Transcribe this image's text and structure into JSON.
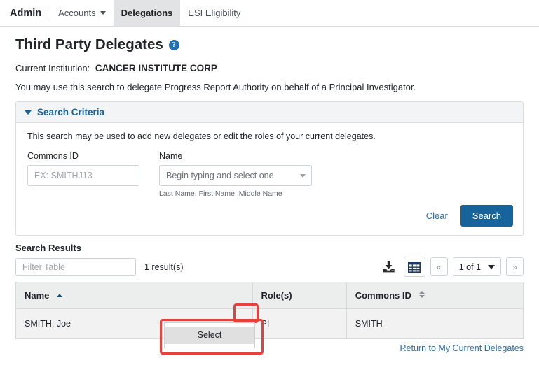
{
  "navbar": {
    "brand": "Admin",
    "items": [
      {
        "label": "Accounts",
        "has_caret": true,
        "active": false
      },
      {
        "label": "Delegations",
        "has_caret": false,
        "active": true
      },
      {
        "label": "ESI Eligibility",
        "has_caret": false,
        "active": false
      }
    ]
  },
  "page": {
    "title": "Third Party Delegates",
    "help_icon": "question-mark-circle-icon",
    "institution_label": "Current Institution:",
    "institution_name": "CANCER INSTITUTE CORP",
    "intro": "You may use this search to delegate Progress Report Authority on behalf of a Principal Investigator."
  },
  "search_criteria": {
    "header": "Search Criteria",
    "caret_icon": "caret-down-icon",
    "description": "This search may be used to add new delegates or edit the roles of your current delegates.",
    "commons_id": {
      "label": "Commons ID",
      "value": "",
      "placeholder": "EX: SMITHJ13"
    },
    "name": {
      "label": "Name",
      "value": "",
      "placeholder": "Begin typing and select one",
      "hint": "Last Name, First Name, Middle Name",
      "caret_icon": "chevron-down-icon"
    },
    "clear_label": "Clear",
    "search_label": "Search"
  },
  "results": {
    "title": "Search Results",
    "filter_placeholder": "Filter Table",
    "filter_value": "",
    "count_text": "1 result(s)",
    "toolbar": {
      "download_icon": "download-icon",
      "columns_icon": "table-grid-icon",
      "prev_label": "«",
      "next_label": "»",
      "page_indicator": "1 of 1",
      "page_caret_icon": "chevron-down-icon"
    },
    "columns": [
      {
        "label": "Name",
        "sort": "asc"
      },
      {
        "label": "Role(s)",
        "sort": "none"
      },
      {
        "label": "Commons ID",
        "sort": "both"
      }
    ],
    "rows": [
      {
        "name": "SMITH, Joe",
        "roles": "PI",
        "commons_id": "SMITH",
        "actions_icon": "ellipsis-horizontal-icon"
      }
    ],
    "dropdown": {
      "visible": true,
      "items": [
        "Select"
      ]
    }
  },
  "footer": {
    "return_link": "Return to My Current Delegates"
  },
  "colors": {
    "primary_blue": "#17639b",
    "link_blue": "#2f6ca8",
    "annotation_red": "#e8413c",
    "active_tab_bg": "#e2e3e5",
    "row_bg": "#f2f2f2",
    "header_bg": "#eceded"
  }
}
